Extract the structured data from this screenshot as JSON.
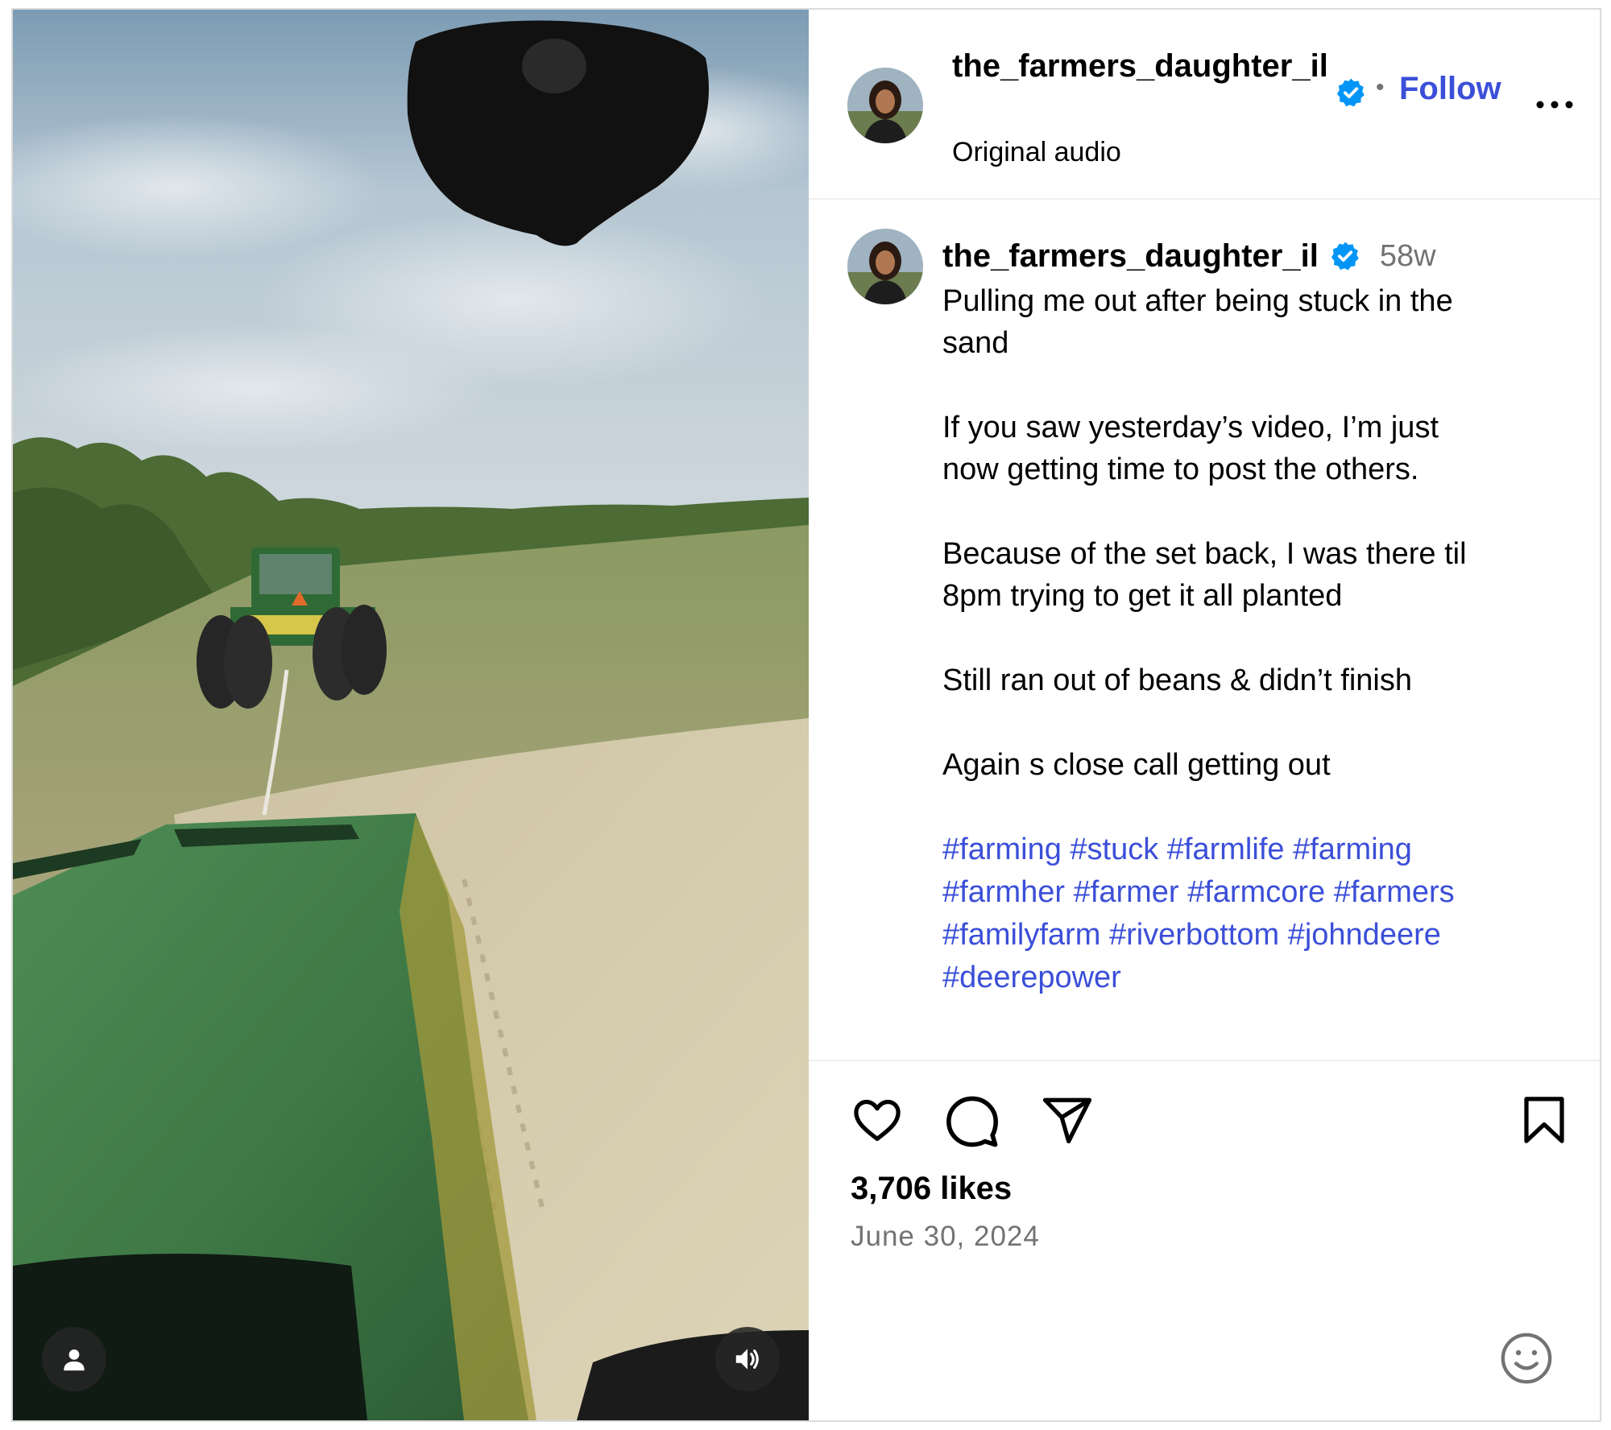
{
  "header": {
    "username": "the_farmers_daughter_il",
    "verified": true,
    "separator": "•",
    "follow_label": "Follow",
    "audio_label": "Original audio",
    "more_icon": "more-horizontal-icon"
  },
  "caption": {
    "username": "the_farmers_daughter_il",
    "time_ago": "58w",
    "paragraphs": [
      [
        "Pulling me out after being stuck in the",
        "sand"
      ],
      [
        "If you saw yesterday’s video, I’m just",
        "now getting time to post the others."
      ],
      [
        "Because of the set back, I was there til",
        "8pm trying to get it all planted"
      ],
      [
        "Still ran out of beans & didn’t finish"
      ],
      [
        "Again s close call getting out"
      ]
    ],
    "hashtag_lines": [
      [
        "#farming",
        "#stuck",
        "#farmlife",
        "#farming"
      ],
      [
        "#farmher",
        "#farmer",
        "#farmcore",
        "#farmers"
      ],
      [
        "#familyfarm",
        "#riverbottom",
        "#johndeere"
      ],
      [
        "#deerepower"
      ]
    ]
  },
  "actions": {
    "like_icon": "heart-icon",
    "comment_icon": "comment-icon",
    "share_icon": "send-icon",
    "save_icon": "bookmark-icon"
  },
  "stats": {
    "likes": "3,706 likes",
    "date": "June 30, 2024"
  },
  "media": {
    "user_tag_icon": "person-icon",
    "audio_icon": "speaker-icon"
  },
  "colors": {
    "link_blue": "#3b4fd8",
    "verified_blue": "#0095f6",
    "secondary_text": "#737373",
    "border": "#dbdbdb"
  }
}
